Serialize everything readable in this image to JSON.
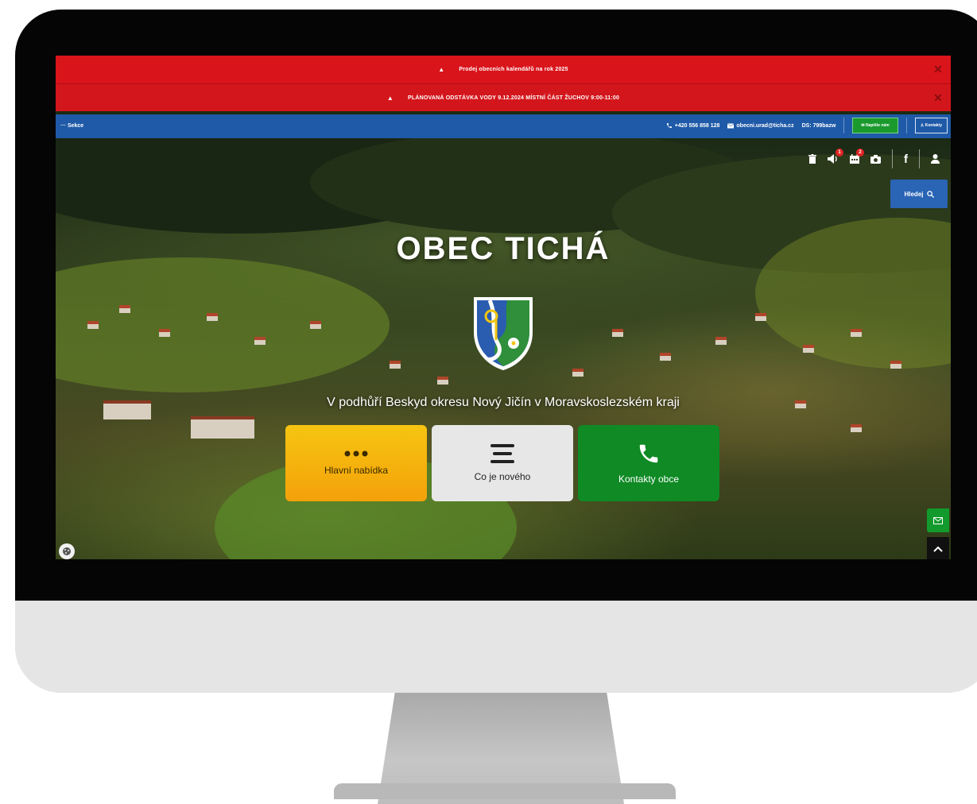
{
  "alerts": [
    {
      "text": "Prodej obecních kalendářů na rok 2025",
      "close": "✕"
    },
    {
      "text": "PLÁNOVANÁ ODSTÁVKA VODY 9.12.2024 MÍSTNÍ ČÁST ŽUCHOV 9:00-11:00",
      "close": "✕"
    }
  ],
  "topbar": {
    "sekce": "··· Sekce",
    "phone": "+420 556 858 128",
    "email": "obecni.urad@ticha.cz",
    "ds": "DS: 799bazw",
    "write_label": "Napište nám",
    "contacts_label": "Kontakty"
  },
  "hero": {
    "title": "OBEC TICHÁ",
    "tagline": "V podhůří Beskyd okresu Nový Jičín v Moravskoslezském kraji",
    "search_label": "Hledej",
    "badges": {
      "announcements": "1",
      "calendar": "2"
    },
    "tiles": [
      {
        "label": "Hlavní nabídka",
        "icon": "dots-icon"
      },
      {
        "label": "Co je nového",
        "icon": "menu-icon"
      },
      {
        "label": "Kontakty obce",
        "icon": "phone-icon"
      }
    ]
  },
  "colors": {
    "alert_red": "#d9141b",
    "topbar_blue": "#1f5aa8",
    "tile_yellow": "#f6c511",
    "tile_green": "#0f8a25"
  }
}
